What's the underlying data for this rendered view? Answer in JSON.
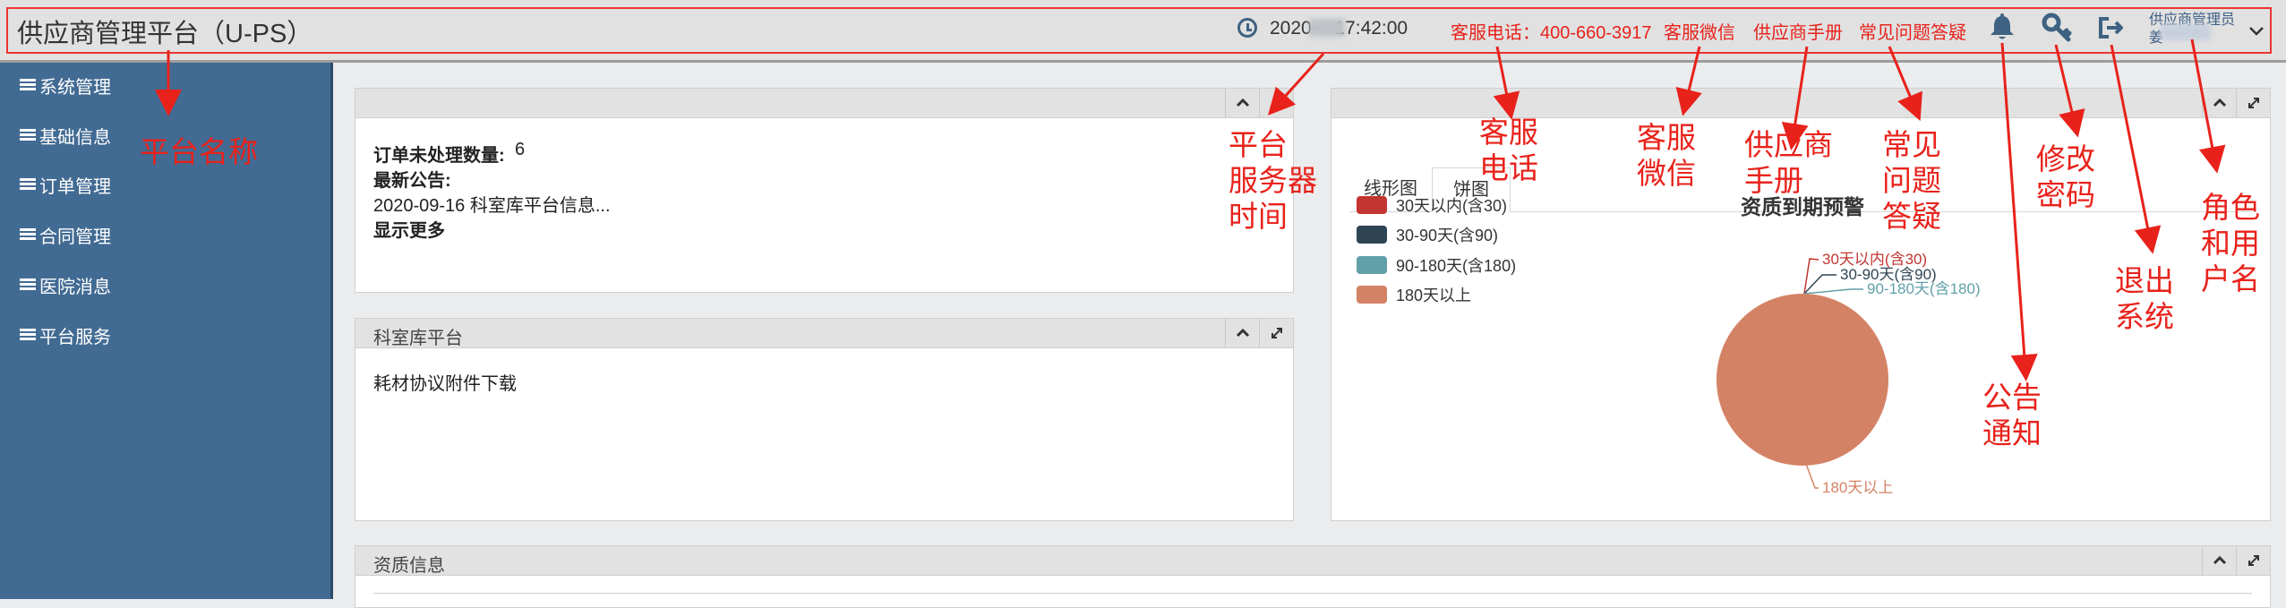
{
  "header": {
    "title": "供应商管理平台（U-PS）",
    "server_time": "2020-  -   17:42:00",
    "service_phone": "客服电话：400-660-3917",
    "service_wechat": "客服微信",
    "supplier_manual": "供应商手册",
    "faq": "常见问题答疑",
    "user_role": "供应商管理员",
    "user_name": "姜"
  },
  "sidebar": {
    "items": [
      {
        "label": "系统管理"
      },
      {
        "label": "基础信息"
      },
      {
        "label": "订单管理"
      },
      {
        "label": "合同管理"
      },
      {
        "label": "医院消息"
      },
      {
        "label": "平台服务"
      }
    ]
  },
  "panels": {
    "summary": {
      "order_label": "订单未处理数量:",
      "order_count": "6",
      "announcement_label": "最新公告:",
      "announcement_text": "2020-09-16 科室库平台信息...",
      "show_more": "显示更多"
    },
    "platform": {
      "title": "科室库平台",
      "download_link": "耗材协议附件下载"
    },
    "qualification": {
      "title": "资质信息"
    }
  },
  "chart_panel": {
    "tabs": [
      {
        "label": "线形图"
      },
      {
        "label": "饼图"
      }
    ],
    "active_tab": 1
  },
  "chart_data": {
    "type": "pie",
    "title": "资质到期预警",
    "legend_position": "top-left",
    "series": [
      {
        "name": "30天以内(含30)",
        "value": 0,
        "color": "#c23531"
      },
      {
        "name": "30-90天(含90)",
        "value": 0,
        "color": "#2f4554"
      },
      {
        "name": "90-180天(含180)",
        "value": 0,
        "color": "#61a0a8"
      },
      {
        "name": "180天以上",
        "value": 100,
        "color": "#d48265"
      }
    ]
  },
  "annotations": {
    "platform_name": "平台名称",
    "server_time": [
      "平台",
      "服务器",
      "时间"
    ],
    "phone": [
      "客服",
      "电话"
    ],
    "wechat": [
      "客服",
      "微信"
    ],
    "manual": [
      "供应商",
      "手册"
    ],
    "faq": [
      "常见",
      "问题",
      "答疑"
    ],
    "notice": [
      "公告",
      "通知"
    ],
    "password": [
      "修改",
      "密码"
    ],
    "logout": [
      "退出",
      "系统"
    ],
    "user": [
      "角色",
      "和用",
      "户名"
    ]
  },
  "colors": {
    "sidebar_bg": "#426b93",
    "annotation_red": "#e8221b",
    "header_link": "#e8221b",
    "accent_blue": "#3e6282"
  }
}
